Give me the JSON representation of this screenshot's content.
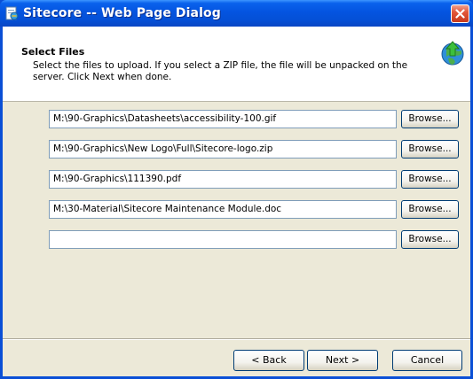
{
  "window": {
    "title": "Sitecore -- Web Page Dialog"
  },
  "header": {
    "title": "Select Files",
    "description": "Select the files to upload. If you select a ZIP file, the file will be unpacked on the server. Click Next when done."
  },
  "files": [
    {
      "value": "M:\\90-Graphics\\Datasheets\\accessibility-100.gif",
      "button": "Browse..."
    },
    {
      "value": "M:\\90-Graphics\\New Logo\\Full\\Sitecore-logo.zip",
      "button": "Browse..."
    },
    {
      "value": "M:\\90-Graphics\\111390.pdf",
      "button": "Browse..."
    },
    {
      "value": "M:\\30-Material\\Sitecore Maintenance Module.doc",
      "button": "Browse..."
    },
    {
      "value": "",
      "button": "Browse..."
    }
  ],
  "footer": {
    "back_label": "< Back",
    "next_label": "Next >",
    "cancel_label": "Cancel"
  },
  "icons": {
    "title": "ie-page-icon",
    "close": "close-icon",
    "header": "globe-upload-icon"
  },
  "colors": {
    "titlebar": "#0454e0",
    "dialog_bg": "#ece9d8",
    "close": "#e2573a"
  }
}
